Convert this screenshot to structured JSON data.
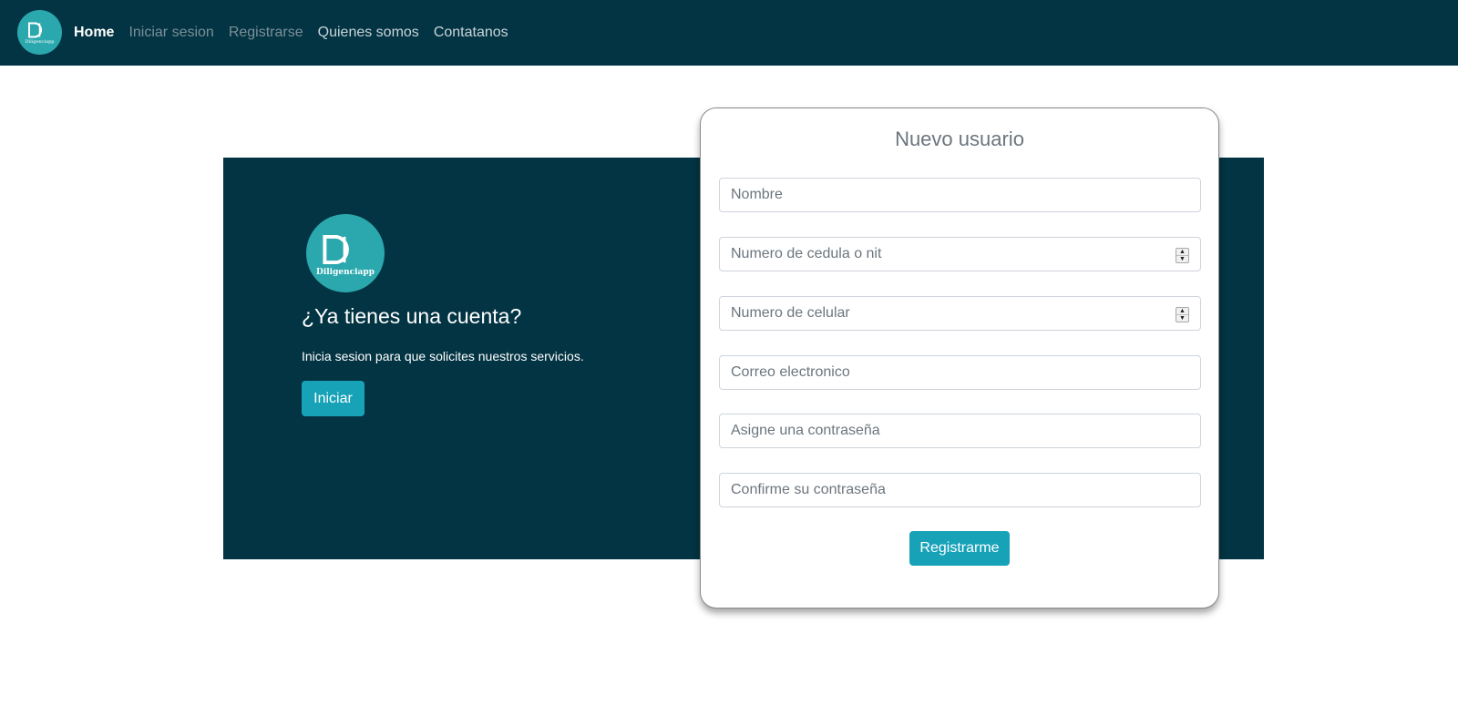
{
  "nav": {
    "logo_text": "Diligenciapp",
    "links": [
      "Home",
      "Iniciar sesion",
      "Registrarse",
      "Quienes somos",
      "Contatanos"
    ]
  },
  "panel": {
    "logo_text": "Diligenciapp",
    "heading": "¿Ya tienes una cuenta?",
    "text": "Inicia sesion para que solicites nuestros servicios.",
    "button": "Iniciar"
  },
  "form": {
    "title": "Nuevo usuario",
    "placeholders": {
      "name": "Nombre",
      "id_number": "Numero de cedula o nit",
      "phone": "Numero de celular",
      "email": "Correo electronico",
      "password": "Asigne una contraseña",
      "confirm_password": "Confirme su contraseña"
    },
    "submit": "Registrarme"
  },
  "icons": {
    "spinner_up": "▲",
    "spinner_down": "▼"
  },
  "colors": {
    "navy": "#033443",
    "teal": "#2aa8ae",
    "button": "#17a2b8"
  }
}
